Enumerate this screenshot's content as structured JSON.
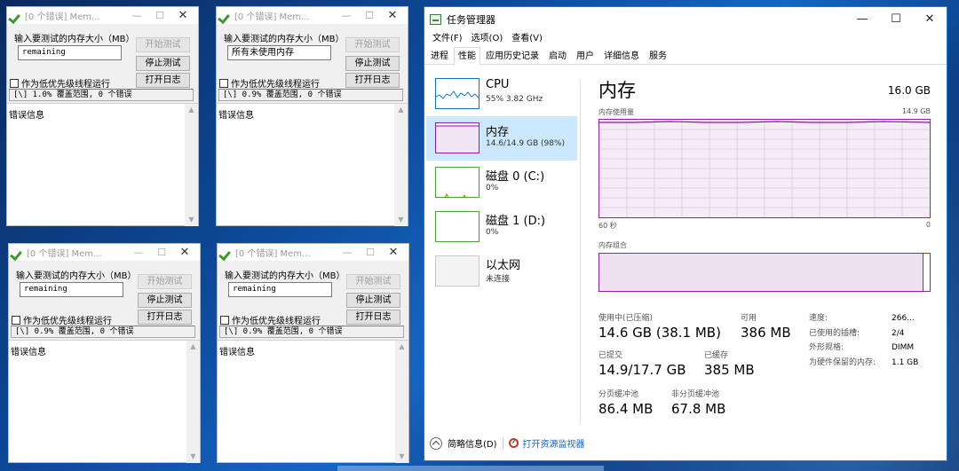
{
  "memtest_windows": [
    {
      "title": "[0 个错误] Mem...",
      "size_label": "输入要测试的内存大小（MB）",
      "size_value": "remaining",
      "start_button": "开始测试",
      "stop_button": "停止测试",
      "log_button": "打开日志",
      "low_priority_label": "作为低优先级线程运行",
      "status": "[\\]  1.0% 覆盖范围, 0 个错误",
      "error_info_label": "错误信息"
    },
    {
      "title": "[0 个错误] Mem...",
      "size_label": "输入要测试的内存大小（MB）",
      "size_value": "所有未使用内存",
      "start_button": "开始测试",
      "stop_button": "停止测试",
      "log_button": "打开日志",
      "low_priority_label": "作为低优先级线程运行",
      "status": "[\\]  0.9% 覆盖范围, 0 个错误",
      "error_info_label": "错误信息"
    },
    {
      "title": "[0 个错误] Mem...",
      "size_label": "输入要测试的内存大小（MB）",
      "size_value": "remaining",
      "start_button": "开始测试",
      "stop_button": "停止测试",
      "log_button": "打开日志",
      "low_priority_label": "作为低优先级线程运行",
      "status": "[\\]  0.9% 覆盖范围, 0 个错误",
      "error_info_label": "错误信息"
    },
    {
      "title": "[0 个错误] Mem...",
      "size_label": "输入要测试的内存大小（MB）",
      "size_value": "remaining",
      "start_button": "开始测试",
      "stop_button": "停止测试",
      "log_button": "打开日志",
      "low_priority_label": "作为低优先级线程运行",
      "status": "[\\]  0.9% 覆盖范围, 0 个错误",
      "error_info_label": "错误信息"
    }
  ],
  "task_manager": {
    "title": "任务管理器",
    "menu": [
      "文件(F)",
      "选项(O)",
      "查看(V)"
    ],
    "tabs": [
      "进程",
      "性能",
      "应用历史记录",
      "启动",
      "用户",
      "详细信息",
      "服务"
    ],
    "active_tab": "性能",
    "sidebar": [
      {
        "name": "CPU",
        "detail": "55%  3.82 GHz",
        "color": "#117dbb"
      },
      {
        "name": "内存",
        "detail": "14.6/14.9 GB (98%)",
        "color": "#8b12ae",
        "selected": true
      },
      {
        "name": "磁盘 0 (C:)",
        "detail": "0%",
        "color": "#4da60c"
      },
      {
        "name": "磁盘 1 (D:)",
        "detail": "0%",
        "color": "#4da60c"
      },
      {
        "name": "以太网",
        "detail": "未连接",
        "color": "#c8c8c8"
      }
    ],
    "memory": {
      "heading": "内存",
      "total": "16.0 GB",
      "usage_label": "内存使用量",
      "usage_max": "14.9 GB",
      "axis_left": "60 秒",
      "axis_right": "0",
      "usage_fraction": 0.98,
      "composition_label": "内存组合",
      "stats": {
        "in_use_label": "使用中(已压缩)",
        "in_use_value": "14.6 GB (38.1 MB)",
        "available_label": "可用",
        "available_value": "386 MB",
        "committed_label": "已提交",
        "committed_value": "14.9/17.7 GB",
        "cached_label": "已缓存",
        "cached_value": "385 MB",
        "paged_label": "分页缓冲池",
        "paged_value": "86.4 MB",
        "nonpaged_label": "非分页缓冲池",
        "nonpaged_value": "67.8 MB"
      },
      "specs": {
        "speed_label": "速度:",
        "speed_value": "266...",
        "slots_label": "已使用的插槽:",
        "slots_value": "2/4",
        "form_label": "外形规格:",
        "form_value": "DIMM",
        "reserved_label": "为硬件保留的内存:",
        "reserved_value": "1.1 GB"
      }
    },
    "footer": {
      "summary": "简略信息(D)",
      "resmon": "打开资源监视器"
    }
  }
}
